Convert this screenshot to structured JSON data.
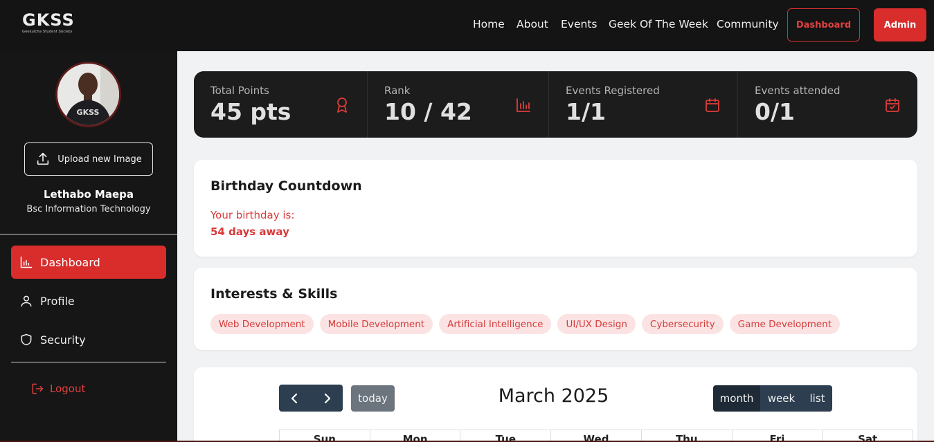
{
  "brand": {
    "logo_text": "GKSS",
    "logo_subtitle": "Geekulcha Student Society"
  },
  "nav": {
    "links": [
      "Home",
      "About",
      "Events",
      "Geek Of The Week",
      "Community"
    ],
    "dashboard_button": "Dashboard",
    "admin_button": "Admin"
  },
  "profile": {
    "upload_label": "Upload new Image",
    "name": "Lethabo Maepa",
    "course": "Bsc Information Technology"
  },
  "sidebar": {
    "items": [
      {
        "label": "Dashboard",
        "icon": "chart-icon",
        "active": true
      },
      {
        "label": "Profile",
        "icon": "user-icon",
        "active": false
      },
      {
        "label": "Security",
        "icon": "shield-icon",
        "active": false
      }
    ],
    "logout_label": "Logout"
  },
  "stats": [
    {
      "label": "Total Points",
      "value": "45 pts",
      "icon": "award-icon"
    },
    {
      "label": "Rank",
      "value": "10 / 42",
      "icon": "bar-chart-icon"
    },
    {
      "label": "Events Registered",
      "value": "1/1",
      "icon": "calendar-icon"
    },
    {
      "label": "Events attended",
      "value": "0/1",
      "icon": "calendar-check-icon"
    }
  ],
  "birthday": {
    "title": "Birthday Countdown",
    "label": "Your birthday is:",
    "value": "54 days away"
  },
  "interests": {
    "title": "Interests & Skills",
    "tags": [
      "Web Development",
      "Mobile Development",
      "Artificial Intelligence",
      "UI/UX Design",
      "Cybersecurity",
      "Game Development"
    ]
  },
  "calendar": {
    "title": "March 2025",
    "today_label": "today",
    "views": [
      {
        "label": "month",
        "active": true
      },
      {
        "label": "week",
        "active": false
      },
      {
        "label": "list",
        "active": false
      }
    ],
    "weekdays": [
      "Sun",
      "Mon",
      "Tue",
      "Wed",
      "Thu",
      "Fri",
      "Sat"
    ]
  },
  "colors": {
    "accent": "#d92d2c",
    "dark": "#141414",
    "calendar_button": "#2c3e50"
  }
}
